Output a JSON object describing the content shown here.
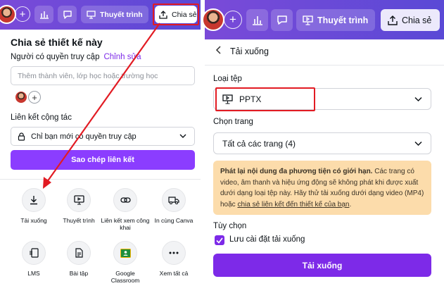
{
  "left": {
    "toolbar": {
      "presentation_label": "Thuyết trình",
      "share_label": "Chia sẻ"
    },
    "panel": {
      "title": "Chia sẻ thiết kế này",
      "access_label": "Người có quyền truy cập",
      "edit_link": "Chỉnh sửa",
      "member_placeholder": "Thêm thành viên, lớp học hoặc trường học",
      "collab_link_label": "Liên kết cộng tác",
      "access_option": "Chỉ bạn mới có quyền truy cập",
      "copy_link_button": "Sao chép liên kết",
      "options": [
        {
          "label": "Tải xuống",
          "icon": "download-icon"
        },
        {
          "label": "Thuyết trình",
          "icon": "presentation-icon"
        },
        {
          "label": "Liên kết xem công khai",
          "icon": "link-icon"
        },
        {
          "label": "In cùng Canva",
          "icon": "truck-icon"
        },
        {
          "label": "LMS",
          "icon": "lms-icon"
        },
        {
          "label": "Bài tập",
          "icon": "assignment-icon"
        },
        {
          "label": "Google Classroom",
          "icon": "google-classroom-icon"
        },
        {
          "label": "Xem tất cả",
          "icon": "more-icon"
        }
      ]
    }
  },
  "right": {
    "toolbar": {
      "presentation_label": "Thuyết trình",
      "share_label": "Chia sẻ"
    },
    "panel": {
      "heading": "Tải xuống",
      "file_type_label": "Loại tệp",
      "file_type_value": "PPTX",
      "pages_label": "Chọn trang",
      "pages_value": "Tất cả các trang (4)",
      "note_bold": "Phát lại nội dung đa phương tiện có giới hạn.",
      "note_text": " Các trang có video, âm thanh và hiệu ứng động sẽ không phát khi được xuất dưới dạng loại tệp này. Hãy thử tải xuống dưới dạng video (MP4) hoặc ",
      "note_link": "chia sẻ liên kết đến thiết kế của bạn",
      "note_end": ".",
      "options_label": "Tùy chọn",
      "save_settings_label": "Lưu cài đặt tải xuống",
      "save_settings_checked": true,
      "download_button": "Tải xuống"
    }
  },
  "colors": {
    "header_gradient_start": "#7a4ad8",
    "header_gradient_end": "#5a49d6",
    "primary": "#7d2ae8",
    "copy_button": "#8b3dff",
    "highlight": "#e21b23",
    "note_bg": "#fcdcab"
  }
}
